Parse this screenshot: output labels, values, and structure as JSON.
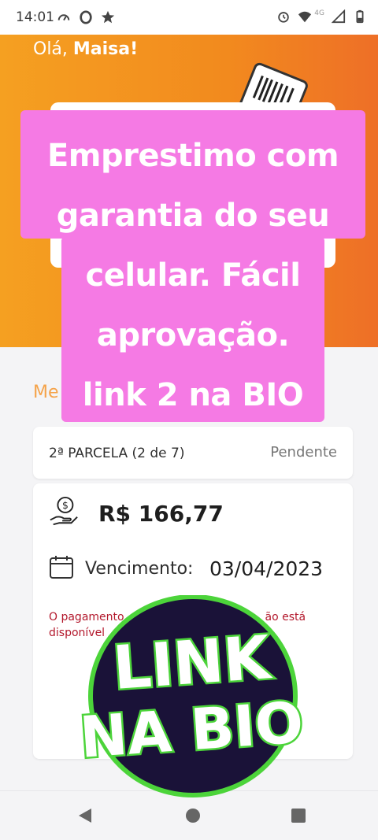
{
  "status_bar": {
    "time": "14:01",
    "network": "4G"
  },
  "hero": {
    "greeting_prefix": "Olá, ",
    "user_name": "Maisa!"
  },
  "section": {
    "label": "Me"
  },
  "installment": {
    "title": "2ª PARCELA (2 de 7)",
    "status": "Pendente",
    "amount": "R$ 166,77",
    "due_label": "Vencimento:",
    "due_date": "03/04/2023",
    "warning_line1": "O pagamento",
    "warning_line1_end": "ão está",
    "warning_line2": "disponível"
  },
  "promo": {
    "lines": [
      "Emprestimo com",
      "garantia do seu",
      "celular. Fácil",
      "aprovação.",
      "link 2 na BIO"
    ]
  },
  "sticker": {
    "line1": "LINK",
    "line2": "NA BIO"
  },
  "colors": {
    "orange": "#f28a1e",
    "pink": "#f57ae4",
    "warning": "#b3182c",
    "sticker_green": "#4cd43a",
    "sticker_dark": "#1a1238"
  }
}
